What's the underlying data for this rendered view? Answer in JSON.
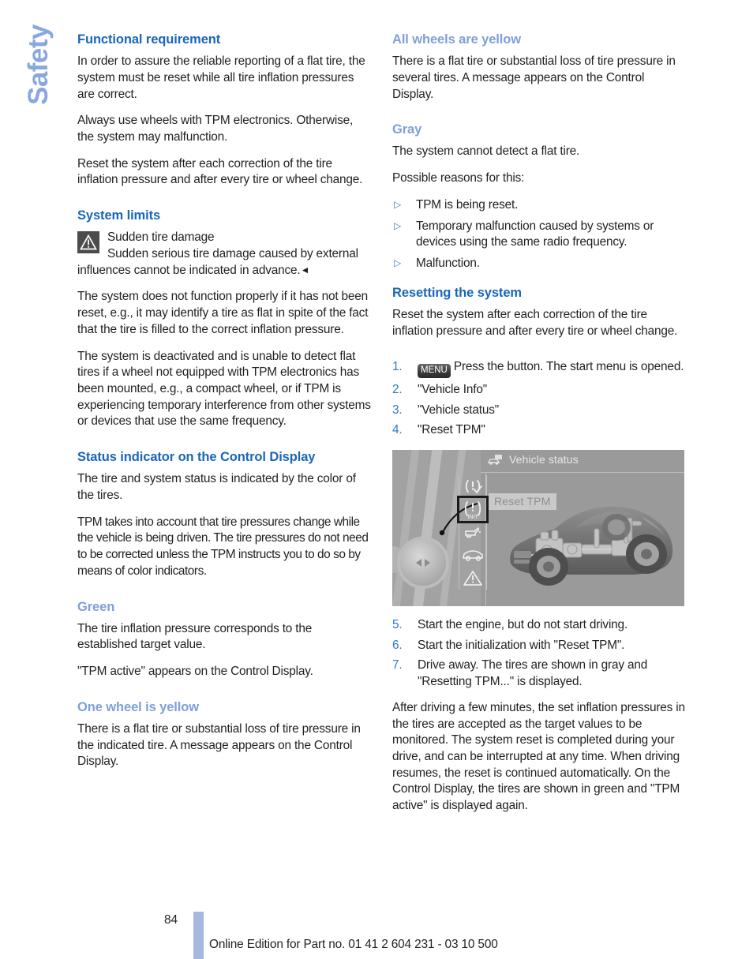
{
  "side_tab": {
    "label": "Safety"
  },
  "left_column": {
    "functional_requirement": {
      "heading": "Functional requirement",
      "paragraphs": [
        "In order to assure the reliable reporting of a flat tire, the system must be reset while all tire inflation pressures are correct.",
        "Always use wheels with TPM electronics. Otherwise, the system may malfunction.",
        "Reset the system after each correction of the tire inflation pressure and after every tire or wheel change."
      ]
    },
    "system_limits": {
      "heading": "System limits",
      "warning": {
        "icon": "warning-triangle-icon",
        "title": "Sudden tire damage",
        "body": "Sudden serious tire damage caused by external influences cannot be indicated in advance.",
        "endmark": "◄"
      },
      "paragraphs": [
        "The system does not function properly if it has not been reset, e.g., it may identify a tire as flat in spite of the fact that the tire is filled to the correct inflation pressure.",
        "The system is deactivated and is unable to detect flat tires if a wheel not equipped with TPM electronics has been mounted, e.g., a compact wheel, or if TPM is experiencing temporary interference from other systems or devices that use the same frequency."
      ]
    },
    "status_indicator": {
      "heading": "Status indicator on the Control Display",
      "paragraphs": [
        "The tire and system status is indicated by the color of the tires.",
        "TPM takes into account that tire pressures change while the vehicle is being driven. The tire pressures do not need to be corrected unless the TPM instructs you to do so by means of color indicators."
      ]
    },
    "green": {
      "heading": "Green",
      "paragraphs": [
        "The tire inflation pressure corresponds to the established target value.",
        "\"TPM active\" appears on the Control Display."
      ]
    },
    "one_wheel_yellow": {
      "heading": "One wheel is yellow",
      "paragraphs": [
        "There is a flat tire or substantial loss of tire pressure in the indicated tire. A message appears on the Control Display."
      ]
    }
  },
  "right_column": {
    "all_wheels_yellow": {
      "heading": "All wheels are yellow",
      "paragraphs": [
        "There is a flat tire or substantial loss of tire pressure in several tires. A message appears on the Control Display."
      ]
    },
    "gray": {
      "heading": "Gray",
      "paragraphs": [
        "The system cannot detect a flat tire.",
        "Possible reasons for this:"
      ],
      "bullets": [
        "TPM is being reset.",
        "Temporary malfunction caused by systems or devices using the same radio frequency.",
        "Malfunction."
      ],
      "bullet_marker": "▷"
    },
    "resetting": {
      "heading": "Resetting the system",
      "intro": "Reset the system after each correction of the tire inflation pressure and after every tire or wheel change.",
      "steps_before_figure": [
        {
          "num": "1.",
          "key": "MENU",
          "text": "Press the button. The start menu is opened."
        },
        {
          "num": "2.",
          "text": "\"Vehicle Info\""
        },
        {
          "num": "3.",
          "text": "\"Vehicle status\""
        },
        {
          "num": "4.",
          "text": "\"Reset TPM\""
        }
      ],
      "steps_after_figure": [
        {
          "num": "5.",
          "text": "Start the engine, but do not start driving."
        },
        {
          "num": "6.",
          "text": "Start the initialization with \"Reset TPM\"."
        },
        {
          "num": "7.",
          "text": "Drive away. The tires are shown in gray and \"Resetting TPM...\" is displayed."
        }
      ],
      "closing_paragraph": "After driving a few minutes, the set inflation pressures in the tires are accepted as the target values to be monitored. The system reset is completed during your drive, and can be interrupted at any time. When driving resumes, the reset is continued automatically. On the Control Display, the tires are shown in green and \"TPM active\" is displayed again."
    },
    "figure": {
      "header_title": "Vehicle status",
      "reset_chip_label": "Reset TPM",
      "icons": [
        "tpm-check-icon",
        "tpm-init-icon",
        "oil-can-icon",
        "car-outline-icon",
        "warning-triangle-icon"
      ]
    }
  },
  "footer": {
    "page_number": "84",
    "text": "Online Edition for Part no. 01 41 2 604 231 - 03 10 500"
  },
  "colors": {
    "heading_blue": "#1a66b8",
    "subheading_blue": "#7e9fd8",
    "tab_blue": "#8aa8de",
    "footer_bar": "#a7b8e2",
    "number_blue": "#2d79c6"
  }
}
